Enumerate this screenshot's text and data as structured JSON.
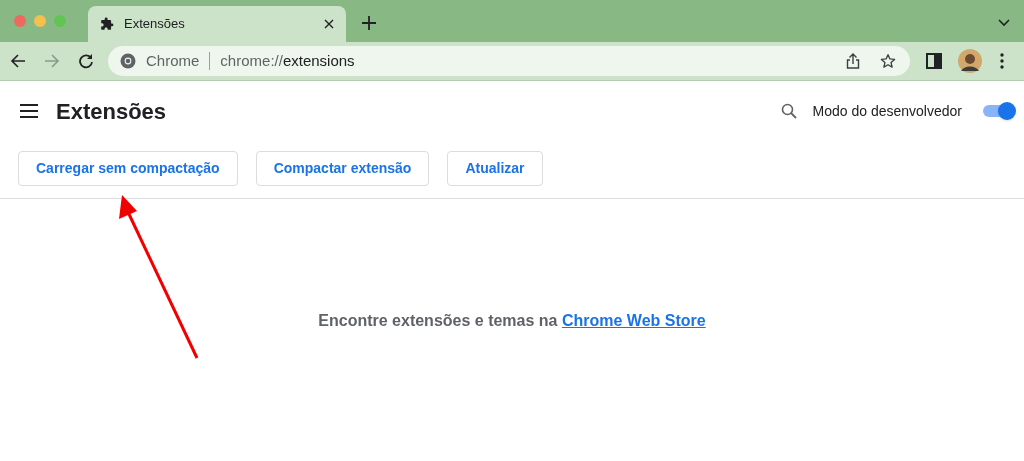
{
  "browser": {
    "tab": {
      "title": "Extensões",
      "selected": true
    },
    "address": {
      "site_label": "Chrome",
      "url_prefix": "chrome://",
      "url_host": "extensions"
    }
  },
  "header": {
    "title": "Extensões",
    "developer_mode": {
      "label": "Modo do desenvolvedor",
      "on": true
    }
  },
  "actions": [
    "Carregar sem compactação",
    "Compactar extensão",
    "Atualizar"
  ],
  "empty": {
    "text": "Encontre extensões e temas na ",
    "link": "Chrome Web Store"
  }
}
